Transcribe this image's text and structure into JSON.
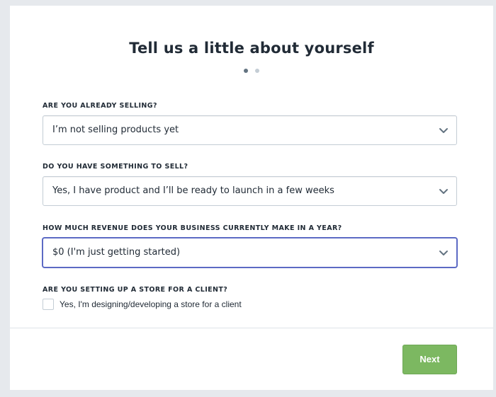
{
  "page": {
    "title": "Tell us a little about yourself",
    "step_indicator": {
      "total": 2,
      "current": 1
    }
  },
  "fields": {
    "selling": {
      "label": "ARE YOU ALREADY SELLING?",
      "value": "I’m not selling products yet"
    },
    "something_to_sell": {
      "label": "DO YOU HAVE SOMETHING TO SELL?",
      "value": "Yes, I have product and I’ll be ready to launch in a few weeks"
    },
    "revenue": {
      "label": "HOW MUCH REVENUE DOES YOUR BUSINESS CURRENTLY MAKE IN A YEAR?",
      "value": "$0 (I'm just getting started)"
    },
    "client_store": {
      "label": "ARE YOU SETTING UP A STORE FOR A CLIENT?",
      "checkbox_label": "Yes, I'm designing/developing a store for a client",
      "checked": false
    }
  },
  "actions": {
    "next_label": "Next"
  },
  "colors": {
    "background": "#e6e9ed",
    "card": "#ffffff",
    "primary_button": "#7cb861",
    "focus_border": "#5c6ac4",
    "text": "#212b36"
  },
  "icons": {
    "select_arrow": "chevron-down-icon"
  }
}
